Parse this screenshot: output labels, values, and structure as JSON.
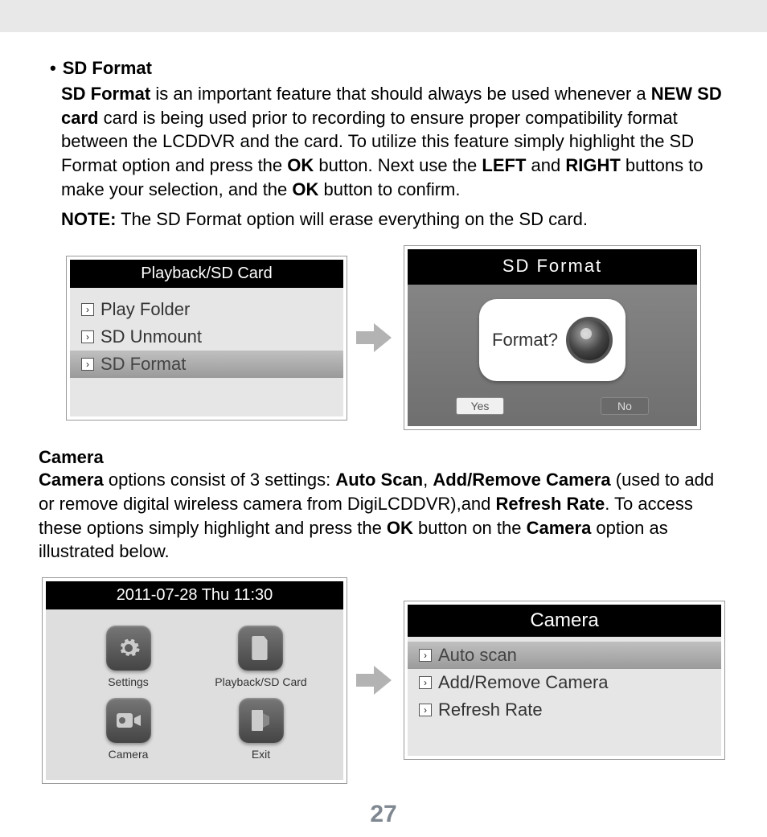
{
  "sdFormat": {
    "heading": "SD Format",
    "para1_parts": {
      "t1": "SD Format",
      "t2": " is an important feature that should always be used whenever a ",
      "t3": "NEW SD card",
      "t4": " card is being used prior to recording to ensure proper compatibility format between the LCDDVR and the card. To utilize this feature simply highlight the SD Format option and press the ",
      "t5": "OK",
      "t6": " button. Next use the ",
      "t7": "LEFT",
      "t8": " and ",
      "t9": "RIGHT",
      "t10": " buttons to make your selection, and the ",
      "t11": "OK",
      "t12": " button to confirm."
    },
    "note_label": "NOTE:",
    "note_text": " The SD Format option will erase everything on the SD card."
  },
  "fig1": {
    "title": "Playback/SD Card",
    "items": {
      "i0": "Play Folder",
      "i1": "SD Unmount",
      "i2": "SD Format"
    }
  },
  "fig2": {
    "title": "SD  Format",
    "prompt": "Format?",
    "yes": "Yes",
    "no": "No"
  },
  "camera": {
    "heading": "Camera",
    "p": {
      "t1": "Camera",
      "t2": " options consist of 3 settings: ",
      "t3": "Auto Scan",
      "t4": ", ",
      "t5": "Add/Remove Camera",
      "t6": " (used to add or remove digital wireless camera from DigiLCDDVR),and ",
      "t7": "Refresh Rate",
      "t8": ". To access these options simply highlight and press the ",
      "t9": "OK",
      "t10": " button on the ",
      "t11": "Camera",
      "t12": " option as illustrated below."
    }
  },
  "fig3": {
    "title": "2011-07-28 Thu  11:30",
    "tiles": {
      "settings": "Settings",
      "playback": "Playback/SD Card",
      "camera": "Camera",
      "exit": "Exit"
    }
  },
  "fig4": {
    "title": "Camera",
    "items": {
      "i0": "Auto scan",
      "i1": "Add/Remove Camera",
      "i2": "Refresh Rate"
    }
  },
  "pageNumber": "27"
}
